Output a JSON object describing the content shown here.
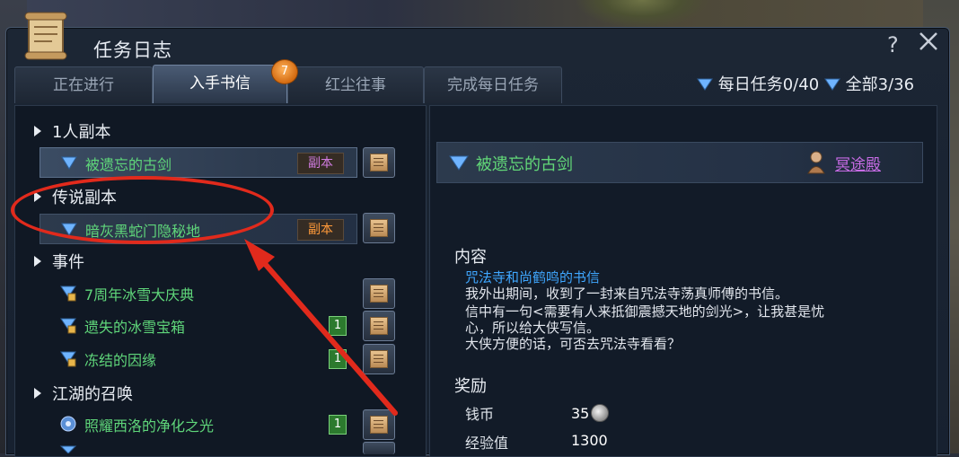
{
  "window": {
    "title": "任务日志",
    "help_label": "?"
  },
  "tabs": [
    {
      "label": "正在进行",
      "active": false
    },
    {
      "label": "入手书信",
      "active": true
    },
    {
      "label": "红尘往事",
      "active": false
    },
    {
      "label": "完成每日任务",
      "active": false
    }
  ],
  "badge": {
    "count": "7"
  },
  "counters": {
    "daily": "每日任务0/40",
    "all": "全部3/36"
  },
  "quest_list": {
    "categories": [
      {
        "label": "1人副本"
      },
      {
        "label": "传说副本"
      },
      {
        "label": "事件"
      },
      {
        "label": "江湖的召唤"
      }
    ],
    "quests": [
      {
        "name": "被遗忘的古剑",
        "tag": "副本",
        "icon": "dungeon-quest-icon",
        "selected": true
      },
      {
        "name": "暗灰黑蛇门隐秘地",
        "tag": "副本",
        "icon": "dungeon-quest-icon",
        "selected": false
      },
      {
        "name": "7周年冰雪大庆典",
        "tag": "",
        "icon": "event-quest-icon",
        "selected": false
      },
      {
        "name": "遗失的冰雪宝箱",
        "num": "1",
        "icon": "event-quest-icon",
        "selected": false
      },
      {
        "name": "冻结的因缘",
        "num": "1",
        "icon": "event-quest-icon",
        "selected": false
      },
      {
        "name": "照耀西洛的净化之光",
        "num": "1",
        "icon": "summon-quest-icon",
        "selected": false
      }
    ]
  },
  "detail": {
    "title": "被遗忘的古剑",
    "npc_link": "冥途殿",
    "content_heading": "内容",
    "letter_title": "咒法寺和尚鹤鸣的书信",
    "content_lines": [
      "我外出期间，收到了一封来自咒法寺荡真师傅的书信。",
      "信中有一句<需要有人来抵御震撼天地的剑光>，让我甚是忧",
      "心，所以给大侠写信。",
      "大侠方便的话，可否去咒法寺看看？"
    ],
    "reward_heading": "奖励",
    "rewards": [
      {
        "label": "钱币",
        "value": "35"
      },
      {
        "label": "经验值",
        "value": "1300"
      }
    ]
  },
  "colors": {
    "quest_green": "#5fd67a",
    "link_purple": "#c86ce6",
    "annotation_red": "#e12a1c"
  }
}
